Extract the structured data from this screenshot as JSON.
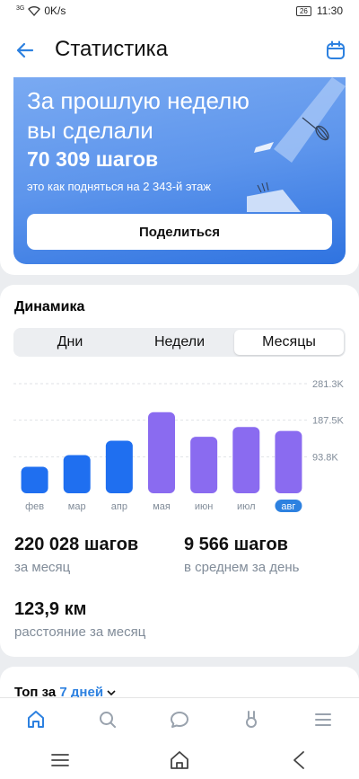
{
  "status_bar": {
    "signal": "3G",
    "network_speed": "0K/s",
    "battery": "26",
    "time": "11:30"
  },
  "header": {
    "title": "Статистика",
    "back_icon": "arrow-left-icon",
    "calendar_icon": "calendar-icon"
  },
  "promo": {
    "heading_line1": "За прошлую неделю",
    "heading_line2": "вы сделали",
    "steps": "70 309 шагов",
    "subtitle": "это как подняться на 2 343-й этаж",
    "share_label": "Поделиться",
    "gradient": [
      "#7aaaf2",
      "#2f73e0"
    ]
  },
  "dynamics": {
    "title": "Динамика",
    "tabs": [
      {
        "label": "Дни",
        "active": false
      },
      {
        "label": "Недели",
        "active": false
      },
      {
        "label": "Месяцы",
        "active": true
      }
    ]
  },
  "chart_data": {
    "type": "bar",
    "categories": [
      "фев",
      "мар",
      "апр",
      "мая",
      "июн",
      "июл",
      "авг"
    ],
    "values": [
      68000,
      98000,
      135000,
      208000,
      145000,
      170000,
      160000
    ],
    "y_tick_labels": [
      "281.3K",
      "187.5K",
      "93.8K"
    ],
    "y_ticks": [
      281300,
      187500,
      93800
    ],
    "ylim": [
      0,
      281300
    ],
    "highlighted_category": "авг",
    "colors": {
      "past": "#1f6ff0",
      "recent": "#8a6bf0"
    },
    "grid": true
  },
  "stats": {
    "month_steps": "220 028 шагов",
    "month_steps_label": "за месяц",
    "avg_steps": "9 566 шагов",
    "avg_steps_label": "в среднем за день",
    "distance": "123,9 км",
    "distance_label": "расстояние за месяц"
  },
  "top": {
    "prefix": "Топ за",
    "period": "7 дней"
  },
  "tabbar": [
    "home-icon",
    "search-icon",
    "chat-icon",
    "services-icon",
    "menu-icon"
  ],
  "navbar": [
    "menu-icon",
    "home-icon",
    "back-icon"
  ]
}
